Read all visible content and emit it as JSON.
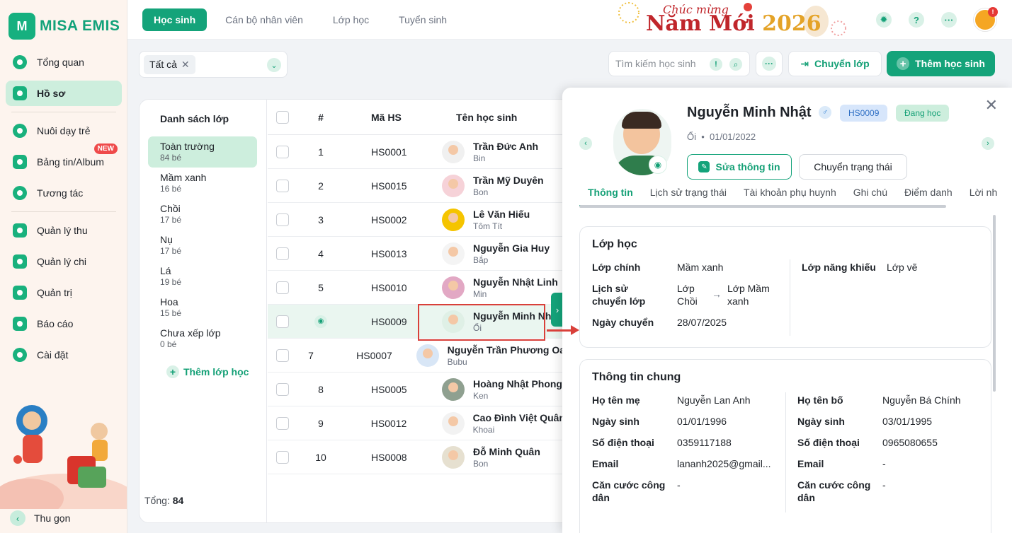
{
  "app": {
    "logo_mark": "M",
    "logo_text": "MISA EMIS"
  },
  "sidebar": {
    "items": [
      {
        "label": "Tổng quan",
        "icon": "pie-chart-icon"
      },
      {
        "label": "Hồ sơ",
        "icon": "profile-icon",
        "active": true
      },
      {
        "label": "Nuôi dạy trẻ",
        "icon": "heart-icon"
      },
      {
        "label": "Bảng tin/Album",
        "icon": "album-icon",
        "badge": "NEW"
      },
      {
        "label": "Tương tác",
        "icon": "send-icon"
      },
      {
        "label": "Quản lý thu",
        "icon": "income-icon"
      },
      {
        "label": "Quản lý chi",
        "icon": "wallet-icon"
      },
      {
        "label": "Quản trị",
        "icon": "admin-icon"
      },
      {
        "label": "Báo cáo",
        "icon": "report-icon"
      },
      {
        "label": "Cài đặt",
        "icon": "gear-icon"
      }
    ],
    "collapse_label": "Thu gọn"
  },
  "topbar": {
    "tabs": [
      "Học sinh",
      "Cán bộ nhân viên",
      "Lớp học",
      "Tuyển sinh"
    ],
    "banner_small": "Chúc mừng",
    "banner_big": "Năm Mới",
    "banner_year": "2026",
    "help": "?",
    "more": "···",
    "notify": "!"
  },
  "filter": {
    "chip": "Tất cả"
  },
  "search": {
    "placeholder": "Tìm kiếm học sinh",
    "info": "!"
  },
  "actions": {
    "more": "···",
    "transfer": "Chuyển lớp",
    "add": "Thêm học sinh"
  },
  "classes": {
    "title": "Danh sách lớp",
    "items": [
      {
        "name": "Toàn trường",
        "count": "84 bé"
      },
      {
        "name": "Mầm xanh",
        "count": "16 bé"
      },
      {
        "name": "Chồi",
        "count": "17 bé"
      },
      {
        "name": "Nụ",
        "count": "17 bé"
      },
      {
        "name": "Lá",
        "count": "19 bé"
      },
      {
        "name": "Hoa",
        "count": "15 bé"
      },
      {
        "name": "Chưa xếp lớp",
        "count": "0 bé"
      }
    ],
    "add": "Thêm lớp học"
  },
  "table": {
    "headers": {
      "num": "#",
      "code": "Mã HS",
      "name": "Tên học sinh"
    },
    "rows": [
      {
        "num": "1",
        "code": "HS0001",
        "name": "Trần Đức Anh",
        "nick": "Bin"
      },
      {
        "num": "2",
        "code": "HS0015",
        "name": "Trần Mỹ Duyên",
        "nick": "Bon"
      },
      {
        "num": "3",
        "code": "HS0002",
        "name": "Lê Văn Hiếu",
        "nick": "Tôm Tít"
      },
      {
        "num": "4",
        "code": "HS0013",
        "name": "Nguyễn Gia Huy",
        "nick": "Bắp"
      },
      {
        "num": "5",
        "code": "HS0010",
        "name": "Nguyễn Nhật Linh",
        "nick": "Min"
      },
      {
        "num": "",
        "code": "HS0009",
        "name": "Nguyễn Minh Nhật",
        "nick": "Ổi"
      },
      {
        "num": "7",
        "code": "HS0007",
        "name": "Nguyễn Trần Phương Oa",
        "nick": "Bubu"
      },
      {
        "num": "8",
        "code": "HS0005",
        "name": "Hoàng Nhật Phong",
        "nick": "Ken"
      },
      {
        "num": "9",
        "code": "HS0012",
        "name": "Cao Đình Việt Quân",
        "nick": "Khoai"
      },
      {
        "num": "10",
        "code": "HS0008",
        "name": "Đỗ Minh Quân",
        "nick": "Bon"
      }
    ],
    "total_label": "Tổng:",
    "total_value": "84"
  },
  "detail": {
    "name": "Nguyễn Minh Nhật",
    "id_badge": "HS0009",
    "status_badge": "Đang học",
    "nickname": "Ổi",
    "dob": "01/01/2022",
    "edit": "Sửa thông tin",
    "change_status": "Chuyển trạng thái",
    "tabs": [
      "Thông tin",
      "Lịch sử trạng thái",
      "Tài khoản phụ huynh",
      "Ghi chú",
      "Điểm danh",
      "Lời nh"
    ],
    "class_section": {
      "title": "Lớp học",
      "main_label": "Lớp chính",
      "main_value": "Mầm xanh",
      "history_label": "Lịch sử chuyển lớp",
      "history_from": "Lớp Chồi",
      "history_to": "Lớp Mầm xanh",
      "date_label": "Ngày chuyển",
      "date_value": "28/07/2025",
      "talent_label": "Lớp năng khiếu",
      "talent_value": "Lớp vẽ"
    },
    "general": {
      "title": "Thông tin chung",
      "mother_label": "Họ tên mẹ",
      "mother": "Nguyễn Lan Anh",
      "father_label": "Họ tên bố",
      "father": "Nguyễn Bá Chính",
      "dob_label": "Ngày sinh",
      "mother_dob": "01/01/1996",
      "father_dob": "03/01/1995",
      "phone_label": "Số điện thoại",
      "mother_phone": "0359117188",
      "father_phone": "0965080655",
      "email_label": "Email",
      "mother_email": "lananh2025@gmail...",
      "father_email": "-",
      "id_label": "Căn cước công dân",
      "mother_id": "-",
      "father_id": "-"
    }
  },
  "colors": {
    "accent": "#14a37a",
    "highlight": "#d9403a"
  }
}
